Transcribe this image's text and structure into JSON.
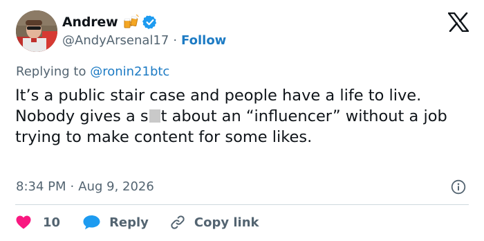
{
  "author": {
    "name": "Andrew",
    "handle": "@AndyArsenal17",
    "follow_label": "Follow",
    "separator": "·"
  },
  "reply": {
    "prefix": "Replying to ",
    "mention": "@ronin21btc"
  },
  "tweet": {
    "text_part1": "It’s a public stair case and people have a life to live. Nobody gives a s",
    "text_part2": "t about an “influencer” without a job trying to make content for some likes."
  },
  "meta": {
    "time": "8:34 PM",
    "separator": "·",
    "date": "Aug 9, 2026"
  },
  "actions": {
    "likes_count": "10",
    "reply_label": "Reply",
    "copy_label": "Copy link"
  },
  "icons": {
    "beer": "beer-mugs-icon",
    "verified": "verified-badge-icon",
    "x_logo": "x-logo-icon",
    "info": "info-icon",
    "heart": "heart-icon",
    "reply": "speech-bubble-icon",
    "link": "link-icon"
  },
  "colors": {
    "text": "#0f1419",
    "secondary": "#536471",
    "link": "#1d7bc4",
    "verified": "#1d9bf0",
    "heart": "#f91880",
    "reply_bubble": "#1d9bf0",
    "divider": "#cfd9de"
  }
}
